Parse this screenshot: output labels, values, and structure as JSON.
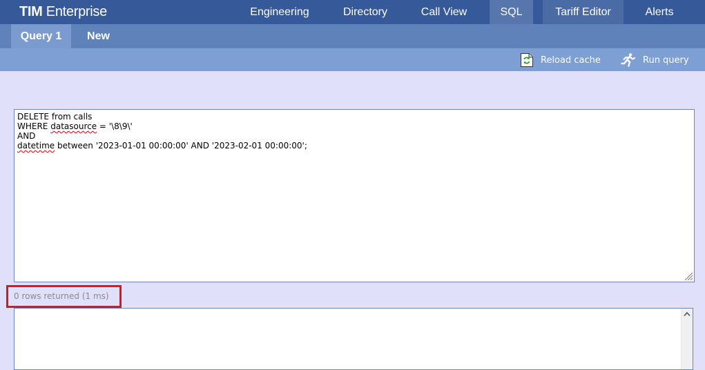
{
  "header": {
    "brand_bold": "TIM",
    "brand_rest": " Enterprise",
    "nav": [
      "Engineering",
      "Directory",
      "Call View",
      "SQL",
      "Tariff Editor",
      "Alerts"
    ]
  },
  "tabs": [
    "Query 1",
    "New"
  ],
  "toolbar": {
    "reload_label": "Reload cache",
    "run_label": "Run query"
  },
  "editor": {
    "line1": "DELETE from calls",
    "line2_prefix": "WHERE ",
    "line2_word": "datasource",
    "line2_suffix": " = '\\8\\9\\'",
    "line3": "AND",
    "line4_word": "datetime",
    "line4_suffix": " between '2023-01-01 00:00:00' AND '2023-02-01 00:00:00';"
  },
  "status": "0 rows returned (1 ms)",
  "colors": {
    "header": "#36599a",
    "tabbar": "#5f82bb",
    "toolbar": "#7e9fd3",
    "background": "#e0e0fb",
    "highlight": "#e0141e"
  }
}
